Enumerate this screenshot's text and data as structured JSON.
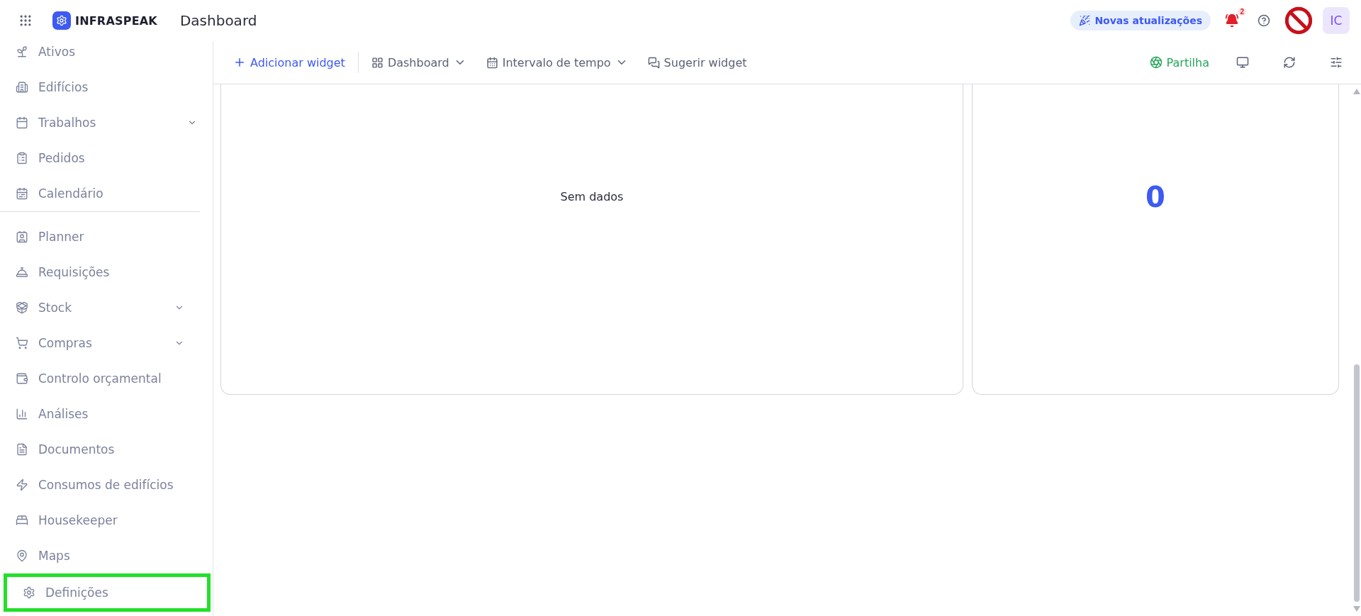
{
  "header": {
    "brand": "INFRASPEAK",
    "title": "Dashboard",
    "updates": "Novas atualizações",
    "notifications": "2",
    "avatar": "IC"
  },
  "sidebar": {
    "sections": [
      [
        {
          "label": "Ativos",
          "expandable": false
        },
        {
          "label": "Edifícios",
          "expandable": false
        },
        {
          "label": "Trabalhos",
          "expandable": true
        },
        {
          "label": "Pedidos",
          "expandable": false
        },
        {
          "label": "Calendário",
          "expandable": false
        }
      ],
      [
        {
          "label": "Planner",
          "expandable": false
        },
        {
          "label": "Requisições",
          "expandable": false
        },
        {
          "label": "Stock",
          "expandable": true
        },
        {
          "label": "Compras",
          "expandable": true
        },
        {
          "label": "Controlo orçamental",
          "expandable": false
        },
        {
          "label": "Análises",
          "expandable": false
        },
        {
          "label": "Documentos",
          "expandable": false
        },
        {
          "label": "Consumos de edifícios",
          "expandable": false
        },
        {
          "label": "Housekeeper",
          "expandable": false
        },
        {
          "label": "Maps",
          "expandable": false
        }
      ]
    ],
    "footer": {
      "label": "Definições",
      "highlighted": true
    }
  },
  "toolbar": {
    "add": "Adicionar widget",
    "dashboard": "Dashboard",
    "interval": "Intervalo de tempo",
    "suggest": "Sugerir widget",
    "share": "Partilha"
  },
  "widgets": [
    {
      "kind": "empty",
      "text": "Sem dados"
    },
    {
      "kind": "number",
      "text": "0"
    }
  ]
}
